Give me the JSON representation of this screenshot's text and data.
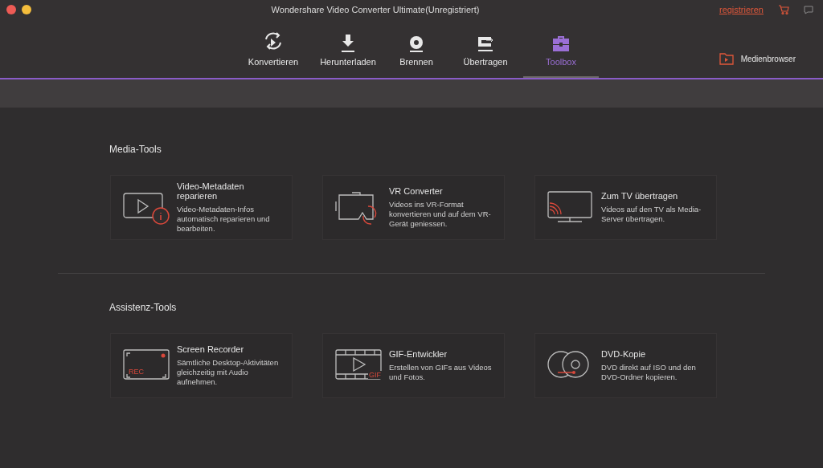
{
  "window": {
    "title": "Wondershare Video Converter Ultimate(Unregistriert)",
    "register_link": "registrieren"
  },
  "nav": [
    {
      "label": "Konvertieren",
      "kind": "convert",
      "selected": false
    },
    {
      "label": "Herunterladen",
      "kind": "download",
      "selected": false
    },
    {
      "label": "Brennen",
      "kind": "burn",
      "selected": false
    },
    {
      "label": "Übertragen",
      "kind": "transfer",
      "selected": false
    },
    {
      "label": "Toolbox",
      "kind": "toolbox",
      "selected": true
    }
  ],
  "media_browser": "Medienbrowser",
  "sections": [
    {
      "title": "Media-Tools",
      "tools": [
        {
          "kind": "metadata",
          "name": "Video-Metadaten reparieren",
          "description": "Video-Metadaten-Infos automatisch reparieren und bearbeiten."
        },
        {
          "kind": "vr",
          "name": "VR Converter",
          "description": "Videos ins VR-Format konvertieren und auf dem VR-Gerät geniessen."
        },
        {
          "kind": "tv",
          "name": "Zum TV übertragen",
          "description": "Videos auf den TV als Media-Server übertragen."
        }
      ]
    },
    {
      "title": "Assistenz-Tools",
      "tools": [
        {
          "kind": "recorder",
          "name": "Screen Recorder",
          "description": "Sämtliche Desktop-Aktivitäten gleichzeitig mit Audio aufnehmen.",
          "badge": "REC"
        },
        {
          "kind": "gif",
          "name": "GIF-Entwickler",
          "description": "Erstellen von GIFs aus Videos und Fotos.",
          "badge": "GIF"
        },
        {
          "kind": "dvd",
          "name": "DVD-Kopie",
          "description": "DVD direkt auf ISO und den DVD-Ordner kopieren."
        }
      ]
    }
  ]
}
